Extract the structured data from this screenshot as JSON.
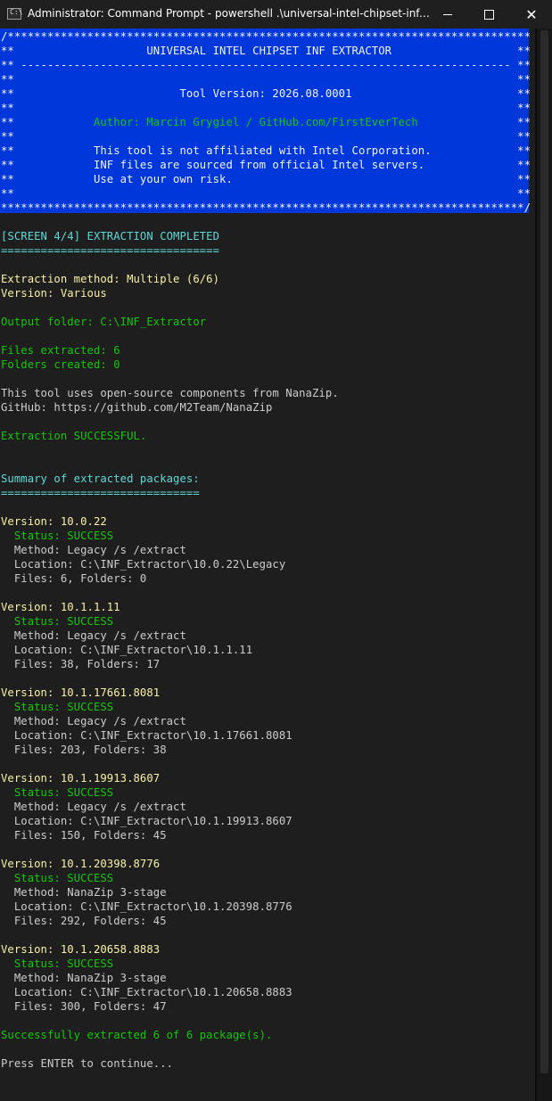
{
  "window": {
    "title": "Administrator: Command Prompt - powershell  .\\universal-intel-chipset-inf-extract...",
    "icon": "cmd-icon",
    "minimize_label": "—",
    "maximize_label": "□",
    "close_label": "✕"
  },
  "colors": {
    "banner_bg": "#0037da",
    "terminal_bg": "#1e1e1e",
    "green": "#16c60c",
    "cyan": "#61d6d6",
    "yellow": "#f9f1a5",
    "gray": "#cccccc"
  },
  "console": {
    "banner": [
      "/*******************************************************************************",
      "**                    UNIVERSAL INTEL CHIPSET INF EXTRACTOR                   **",
      "** -------------------------------------------------------------------------- **",
      "**                                                                            **",
      "**                         Tool Version: 2026.08.0001                         **",
      "**                                                                            **",
      "**            Author: Marcin Grygiel / GitHub.com/FirstEverTech               **",
      "**                                                                            **",
      "**            This tool is not affiliated with Intel Corporation.             **",
      "**            INF files are sourced from official Intel servers.              **",
      "**            Use at your own risk.                                           **",
      "**                                                                            **",
      "*******************************************************************************/"
    ],
    "banner_author": "Author: Marcin Grygiel / GitHub.com/FirstEverTech",
    "screen_heading": "[SCREEN 4/4] EXTRACTION COMPLETED",
    "screen_underline": "=================================",
    "extraction_method": "Extraction method: Multiple (6/6)",
    "version_line": "Version: Various",
    "output_folder": "Output folder: C:\\INF_Extractor",
    "files_extracted": "Files extracted: 6",
    "folders_created": "Folders created: 0",
    "opensource_note": "This tool uses open-source components from NanaZip.",
    "github_line": "GitHub: https://github.com/M2Team/NanaZip",
    "extraction_result": "Extraction SUCCESSFUL.",
    "summary_heading": "Summary of extracted packages:",
    "summary_underline": "==============================",
    "packages": [
      {
        "version": "Version: 10.0.22",
        "status": "  Status: SUCCESS",
        "method": "  Method: Legacy /s /extract",
        "location": "  Location: C:\\INF_Extractor\\10.0.22\\Legacy",
        "files": "  Files: 6, Folders: 0"
      },
      {
        "version": "Version: 10.1.1.11",
        "status": "  Status: SUCCESS",
        "method": "  Method: Legacy /s /extract",
        "location": "  Location: C:\\INF_Extractor\\10.1.1.11",
        "files": "  Files: 38, Folders: 17"
      },
      {
        "version": "Version: 10.1.17661.8081",
        "status": "  Status: SUCCESS",
        "method": "  Method: Legacy /s /extract",
        "location": "  Location: C:\\INF_Extractor\\10.1.17661.8081",
        "files": "  Files: 203, Folders: 38"
      },
      {
        "version": "Version: 10.1.19913.8607",
        "status": "  Status: SUCCESS",
        "method": "  Method: Legacy /s /extract",
        "location": "  Location: C:\\INF_Extractor\\10.1.19913.8607",
        "files": "  Files: 150, Folders: 45"
      },
      {
        "version": "Version: 10.1.20398.8776",
        "status": "  Status: SUCCESS",
        "method": "  Method: NanaZip 3-stage",
        "location": "  Location: C:\\INF_Extractor\\10.1.20398.8776",
        "files": "  Files: 292, Folders: 45"
      },
      {
        "version": "Version: 10.1.20658.8883",
        "status": "  Status: SUCCESS",
        "method": "  Method: NanaZip 3-stage",
        "location": "  Location: C:\\INF_Extractor\\10.1.20658.8883",
        "files": "  Files: 300, Folders: 47"
      }
    ],
    "final_summary": "Successfully extracted 6 of 6 package(s).",
    "prompt": "Press ENTER to continue..."
  }
}
